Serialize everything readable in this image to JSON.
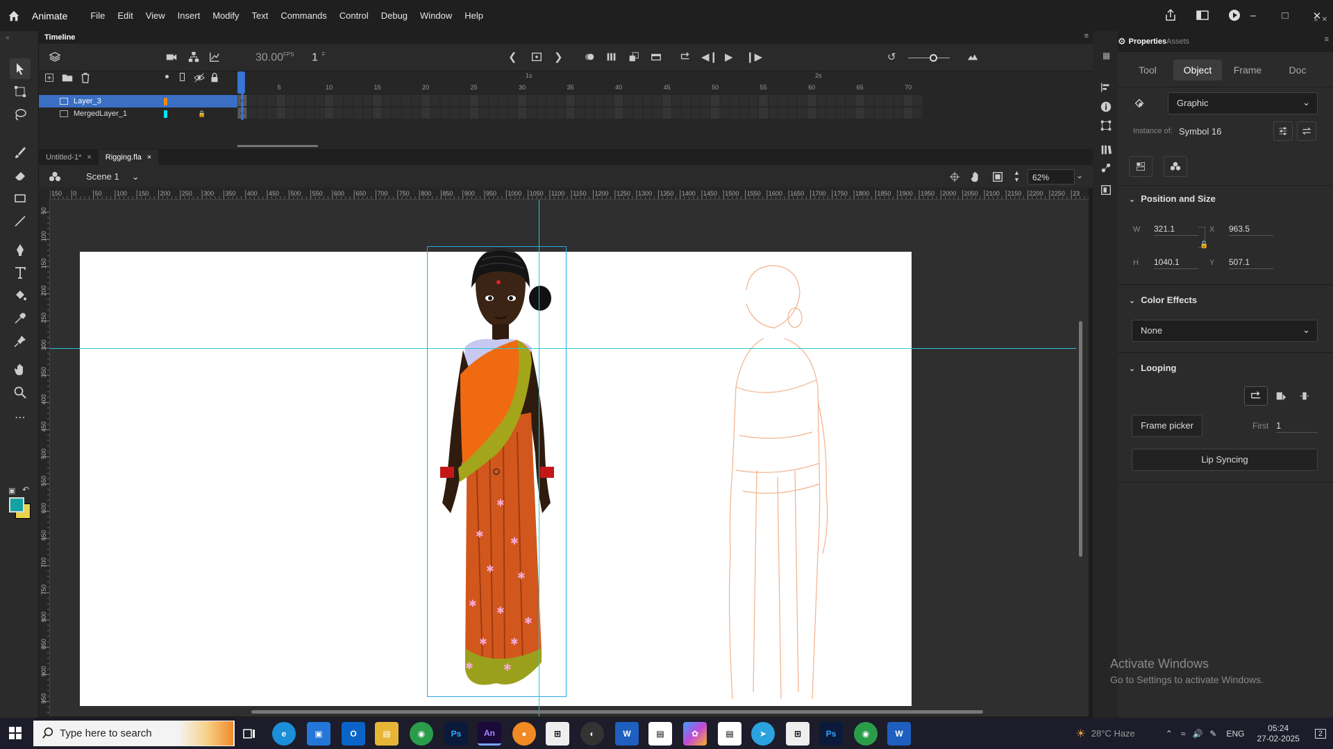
{
  "menubar": {
    "app_name": "Animate",
    "items": [
      "File",
      "Edit",
      "View",
      "Insert",
      "Modify",
      "Text",
      "Commands",
      "Control",
      "Debug",
      "Window",
      "Help"
    ]
  },
  "timeline": {
    "title": "Timeline",
    "fps": "30.00",
    "fps_unit": "FPS",
    "frame": "1",
    "frame_unit": "F",
    "layers": [
      {
        "name": "Layer_3",
        "color": "#ff8a00",
        "selected": true,
        "locked": false
      },
      {
        "name": "MergedLayer_1",
        "color": "#00e5ff",
        "selected": false,
        "locked": true
      }
    ],
    "frame_numbers": [
      "5",
      "10",
      "15",
      "20",
      "25",
      "30",
      "35",
      "40",
      "45",
      "50",
      "55",
      "60",
      "65",
      "70"
    ],
    "seconds": [
      "1s",
      "2s"
    ]
  },
  "document_tabs": [
    {
      "label": "Untitled-1*",
      "active": false
    },
    {
      "label": "Rigging.fla",
      "active": true
    }
  ],
  "scene": {
    "label": "Scene 1",
    "zoom": "62%"
  },
  "ruler": {
    "h_labels": [
      "150",
      "0",
      "50",
      "100",
      "150",
      "200",
      "250",
      "300",
      "350",
      "400",
      "450",
      "500",
      "550",
      "600",
      "650",
      "700",
      "750",
      "800",
      "850",
      "900",
      "950",
      "1000",
      "1050",
      "1100",
      "1150",
      "1200",
      "1250",
      "1300",
      "1350",
      "1400",
      "1450",
      "1500",
      "1550",
      "1600",
      "1650",
      "1700",
      "1750",
      "1800",
      "1850",
      "1900",
      "1950",
      "2000",
      "2050",
      "2100",
      "2150",
      "2200",
      "2250",
      "23"
    ],
    "v_labels": [
      "50",
      "100",
      "150",
      "200",
      "250",
      "300",
      "350",
      "400",
      "450",
      "500",
      "550",
      "600",
      "650",
      "700",
      "750",
      "800",
      "850",
      "900",
      "950"
    ]
  },
  "properties": {
    "panel_tabs": [
      "Properties",
      "Assets"
    ],
    "tabs": [
      "Tool",
      "Object",
      "Frame",
      "Doc"
    ],
    "selected_tab": "Object",
    "symbol_type": "Graphic",
    "instance_of_label": "Instance of:",
    "instance_of": "Symbol 16",
    "position_size": {
      "title": "Position and Size",
      "w_label": "W",
      "w": "321.1",
      "h_label": "H",
      "h": "1040.1",
      "x_label": "X",
      "x": "963.5",
      "y_label": "Y",
      "y": "507.1"
    },
    "color_effects": {
      "title": "Color Effects",
      "value": "None"
    },
    "looping": {
      "title": "Looping",
      "frame_picker": "Frame picker",
      "first_label": "First",
      "first": "1",
      "lip_syncing": "Lip Syncing"
    }
  },
  "watermark": {
    "line1": "Activate Windows",
    "line2": "Go to Settings to activate Windows."
  },
  "taskbar": {
    "search_placeholder": "Type here to search",
    "weather": "28°C  Haze",
    "lang": "ENG",
    "time": "05:24",
    "date": "27-02-2025",
    "notifications": "2",
    "apps": [
      "task-view",
      "edge",
      "store",
      "outlook",
      "file-explorer",
      "chrome",
      "Ps",
      "An",
      "app-orange",
      "capcut",
      "obs",
      "W",
      "notepad",
      "copilot",
      "notepad2",
      "telegram",
      "capcut2",
      "Ps",
      "chrome2",
      "W"
    ]
  }
}
